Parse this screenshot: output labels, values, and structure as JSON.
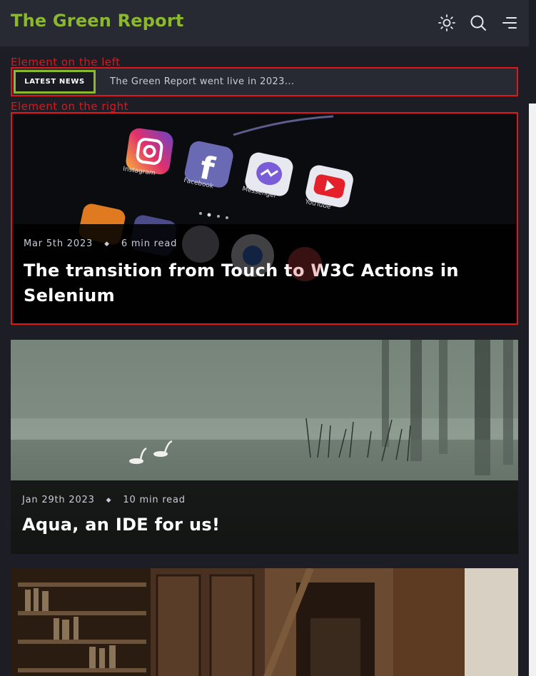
{
  "brand": {
    "title": "The Green Report",
    "color": "#8bb82c"
  },
  "header_icons": [
    "sun-icon",
    "search-icon",
    "menu-icon"
  ],
  "annotations": {
    "left": "Element on the left",
    "right": "Element on the right",
    "color": "#e0161b"
  },
  "ticker": {
    "badge": "LATEST NEWS",
    "text": "The Green Report went live in 2023..."
  },
  "articles": [
    {
      "date": "Mar 5th 2023",
      "separator": "◆",
      "read_time": "6 min read",
      "title": "The transition from Touch to W3C Actions in Selenium",
      "app_labels": [
        "Instagram",
        "Facebook",
        "Messenger",
        "YouTube"
      ]
    },
    {
      "date": "Jan 29th 2023",
      "separator": "◆",
      "read_time": "10 min read",
      "title": "Aqua, an IDE for us!"
    },
    {
      "date": "",
      "read_time": "",
      "title": ""
    }
  ]
}
